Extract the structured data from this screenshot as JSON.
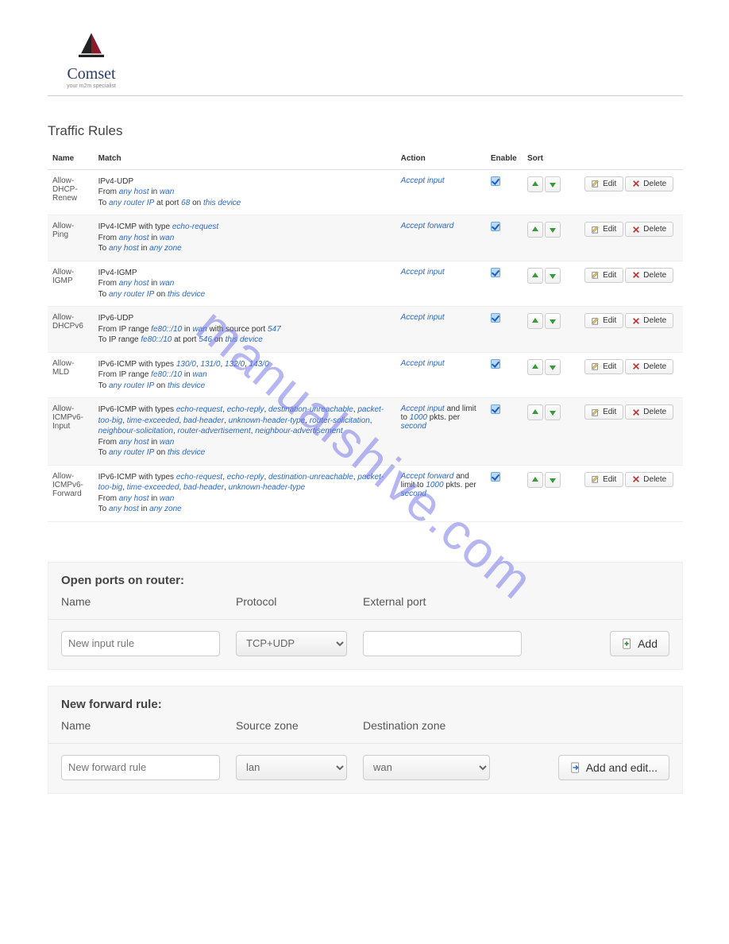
{
  "brand": {
    "name": "Comset",
    "tagline": "your m2m specialist"
  },
  "watermark": "manualshive.com",
  "table": {
    "title": "Traffic Rules",
    "headers": {
      "name": "Name",
      "match": "Match",
      "action": "Action",
      "enable": "Enable",
      "sort": "Sort"
    },
    "edit_label": "Edit",
    "delete_label": "Delete",
    "rules": [
      {
        "name": "Allow-DHCP-Renew",
        "match_html": "IPv4-UDP<br>From <span class='kw'>any host</span> in <span class='kw'>wan</span><br>To <span class='kw'>any router IP</span> at port <span class='kw'>68</span> on <span class='kw'>this device</span>",
        "action_html": "<span class='act-em'>Accept input</span>",
        "enabled": true
      },
      {
        "name": "Allow-Ping",
        "match_html": "IPv4-ICMP with type <span class='kw'>echo-request</span><br>From <span class='kw'>any host</span> in <span class='kw'>wan</span><br>To <span class='kw'>any host</span> in <span class='kw'>any zone</span>",
        "action_html": "<span class='act-em'>Accept forward</span>",
        "enabled": true
      },
      {
        "name": "Allow-IGMP",
        "match_html": "IPv4-IGMP<br>From <span class='kw'>any host</span> in <span class='kw'>wan</span><br>To <span class='kw'>any router IP</span> on <span class='kw'>this device</span>",
        "action_html": "<span class='act-em'>Accept input</span>",
        "enabled": true
      },
      {
        "name": "Allow-DHCPv6",
        "match_html": "IPv6-UDP<br>From IP range <span class='kw'>fe80::/10</span> in <span class='kw'>wan</span> with source port <span class='kw'>547</span><br>To IP range <span class='kw'>fe80::/10</span> at port <span class='kw'>546</span> on <span class='kw'>this device</span>",
        "action_html": "<span class='act-em'>Accept input</span>",
        "enabled": true
      },
      {
        "name": "Allow-MLD",
        "match_html": "IPv6-ICMP with types <span class='kw'>130/0</span>, <span class='kw'>131/0</span>, <span class='kw'>132/0</span>, <span class='kw'>143/0</span><br>From IP range <span class='kw'>fe80::/10</span> in <span class='kw'>wan</span><br>To <span class='kw'>any router IP</span> on <span class='kw'>this device</span>",
        "action_html": "<span class='act-em'>Accept input</span>",
        "enabled": true
      },
      {
        "name": "Allow-ICMPv6-Input",
        "match_html": "IPv6-ICMP with types <span class='kw'>echo-request</span>, <span class='kw'>echo-reply</span>, <span class='kw'>destination-unreachable</span>, <span class='kw'>packet-too-big</span>, <span class='kw'>time-exceeded</span>, <span class='kw'>bad-header</span>, <span class='kw'>unknown-header-type</span>, <span class='kw'>router-solicitation</span>, <span class='kw'>neighbour-solicitation</span>, <span class='kw'>router-advertisement</span>, <span class='kw'>neighbour-advertisement</span><br>From <span class='kw'>any host</span> in <span class='kw'>wan</span><br>To <span class='kw'>any router IP</span> on <span class='kw'>this device</span>",
        "action_html": "<span class='act-em'>Accept input</span> and limit to <span class='kw'>1000</span> pkts. per <span class='kw'>second</span>",
        "enabled": true
      },
      {
        "name": "Allow-ICMPv6-Forward",
        "match_html": "IPv6-ICMP with types <span class='kw'>echo-request</span>, <span class='kw'>echo-reply</span>, <span class='kw'>destination-unreachable</span>, <span class='kw'>packet-too-big</span>, <span class='kw'>time-exceeded</span>, <span class='kw'>bad-header</span>, <span class='kw'>unknown-header-type</span><br>From <span class='kw'>any host</span> in <span class='kw'>wan</span><br>To <span class='kw'>any host</span> in <span class='kw'>any zone</span>",
        "action_html": "<span class='act-em'>Accept forward</span> and limit to <span class='kw'>1000</span> pkts. per <span class='kw'>second</span>",
        "enabled": true
      }
    ]
  },
  "open_ports": {
    "title": "Open ports on router:",
    "name_label": "Name",
    "protocol_label": "Protocol",
    "port_label": "External port",
    "name_placeholder": "New input rule",
    "protocol_value": "TCP+UDP",
    "add_label": "Add"
  },
  "forward": {
    "title": "New forward rule:",
    "name_label": "Name",
    "src_label": "Source zone",
    "dst_label": "Destination zone",
    "name_placeholder": "New forward rule",
    "src_value": "lan",
    "dst_value": "wan",
    "add_label": "Add and edit..."
  }
}
